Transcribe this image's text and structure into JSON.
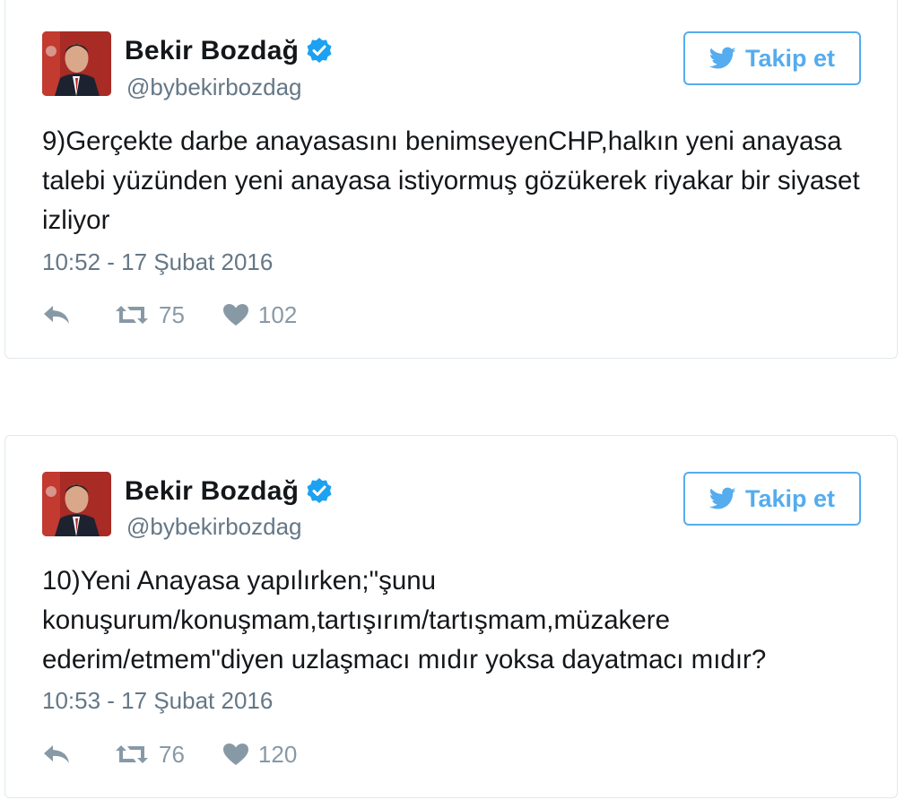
{
  "tweets": [
    {
      "author": {
        "name": "Bekir Bozdağ",
        "handle": "@bybekirbozdag",
        "verified": true
      },
      "follow_label": "Takip et",
      "text": "9)Gerçekte darbe anayasasını benimseyenCHP,halkın yeni anayasa talebi yüzünden yeni anayasa istiyormuş gözükerek riyakar bir siyaset izliyor",
      "timestamp": "10:52 - 17 Şubat 2016",
      "retweets": "75",
      "likes": "102"
    },
    {
      "author": {
        "name": "Bekir Bozdağ",
        "handle": "@bybekirbozdag",
        "verified": true
      },
      "follow_label": "Takip et",
      "text": "10)Yeni Anayasa yapılırken;\"şunu konuşurum/konuşmam,tartışırım/tartışmam,müzakere ederim/etmem\"diyen uzlaşmacı mıdır yoksa dayatmacı mıdır?",
      "timestamp": "10:53 - 17 Şubat 2016",
      "retweets": "76",
      "likes": "120"
    }
  ],
  "icons": {
    "verified": "verified-badge-icon",
    "twitter": "twitter-bird-icon",
    "reply": "reply-arrow-icon",
    "retweet": "retweet-icon",
    "like": "heart-icon"
  },
  "colors": {
    "accent": "#55acee",
    "verified": "#1da1f2",
    "muted": "#657786",
    "action": "#8899a6",
    "text": "#14171a",
    "border": "#e1e8ed"
  }
}
